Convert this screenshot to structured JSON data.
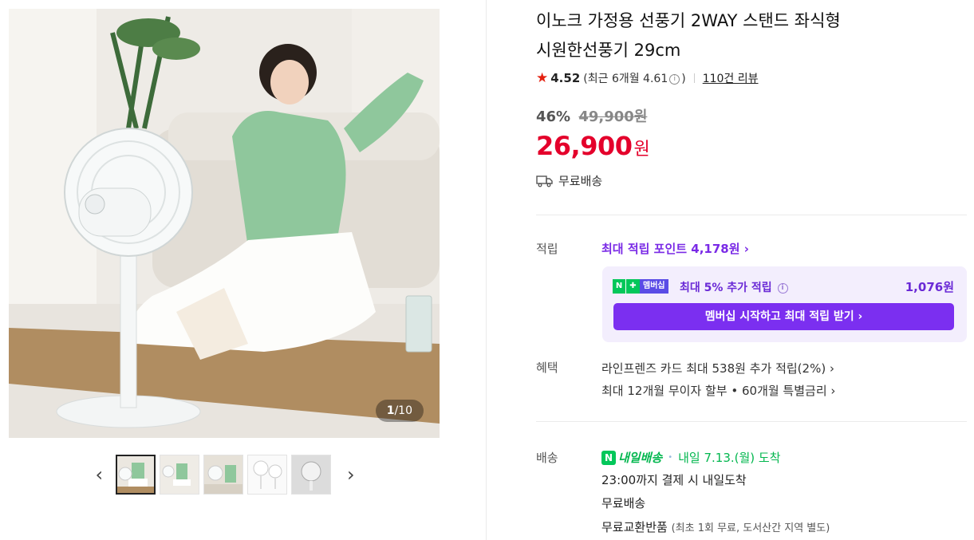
{
  "gallery": {
    "counter_current": "1",
    "counter_total": "/10",
    "prev_icon": "chevron-left-icon",
    "next_icon": "chevron-right-icon",
    "thumbnail_count": 5
  },
  "product": {
    "title_line1": "이노크 가정용 선풍기 2WAY 스탠드 좌식형",
    "title_line2": "시원한선풍기 29cm",
    "rating": "4.52",
    "recent_rating_prefix": "(최근 6개월 4.61",
    "recent_rating_suffix": ")",
    "review_count": "110건 리뷰",
    "discount_rate": "46%",
    "original_price": "49,900원",
    "price": "26,900",
    "price_unit": "원",
    "shipping": "무료배송"
  },
  "points": {
    "label": "적립",
    "max_points": "최대 적립 포인트 4,178원 ›",
    "membership_badge": "멤버십",
    "membership_text": "최대 5% 추가 적립",
    "membership_amount": "1,076원",
    "membership_button": "멤버십 시작하고 최대 적립 받기 ›"
  },
  "benefits": {
    "label": "혜택",
    "card": "라인프렌즈 카드 최대 538원 추가 적립(2%) ›",
    "installment": "최대 12개월 무이자 할부 • 60개월 특별금리 ›"
  },
  "delivery": {
    "label": "배송",
    "badge_n": "N",
    "badge_name": "내일배송",
    "arrival": "내일 7.13.(월) 도착",
    "cutoff": "23:00까지 결제 시 내일도착",
    "shipping": "무료배송",
    "returns": "무료교환반품",
    "returns_note": "(최초 1회 무료, 도서산간 지역 별도)"
  },
  "colors": {
    "price_red": "#e4002b",
    "accent_purple": "#7b2ff0",
    "naver_green": "#03c75a",
    "star": "#e4200f"
  }
}
